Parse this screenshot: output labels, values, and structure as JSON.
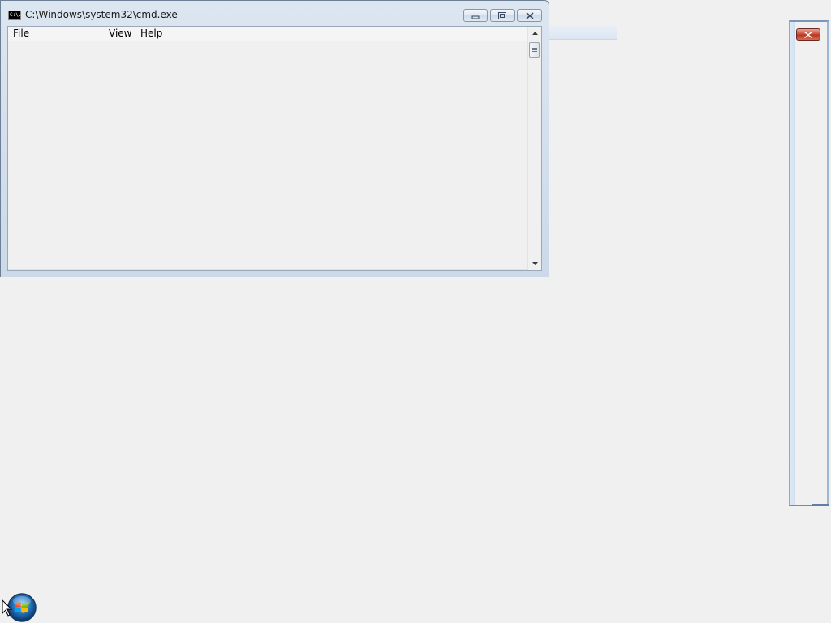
{
  "window": {
    "title": "C:\\Windows\\system32\\cmd.exe",
    "app_icon_text": "C:\\."
  },
  "menu": {
    "file": "File",
    "view": "View",
    "help": "Help"
  },
  "colors": {
    "desktop": "#f0f0f0",
    "frame": "#cbd9e9",
    "close_red": "#c94b36"
  },
  "icons": {
    "minimize": "minimize-icon",
    "maximize": "restore-icon",
    "close": "close-icon",
    "scroll_up": "arrow-up-icon",
    "scroll_down": "arrow-down-icon",
    "start": "windows-start-orb"
  }
}
